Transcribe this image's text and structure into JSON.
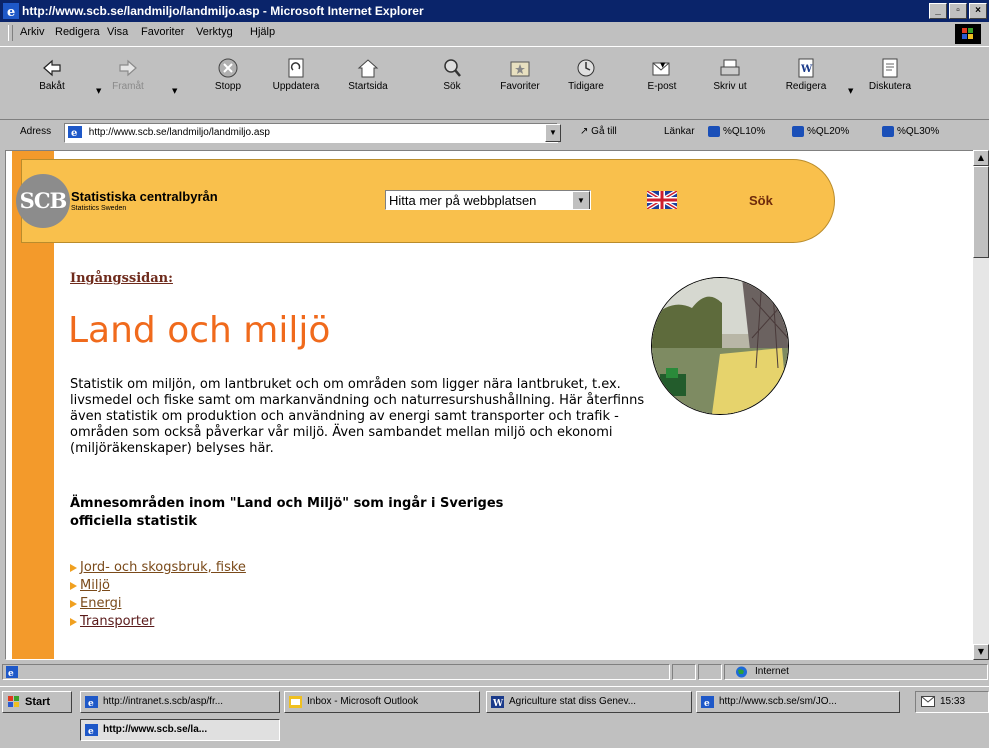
{
  "window": {
    "title": "http://www.scb.se/landmiljo/landmiljo.asp - Microsoft Internet Explorer"
  },
  "menu": [
    "Arkiv",
    "Redigera",
    "Visa",
    "Favoriter",
    "Verktyg",
    "Hjälp"
  ],
  "toolbar": {
    "back": "Bakåt",
    "forward": "Framåt",
    "stop": "Stopp",
    "refresh": "Uppdatera",
    "home": "Startsida",
    "search": "Sök",
    "favorites": "Favoriter",
    "history": "Tidigare",
    "mail": "E-post",
    "print": "Skriv ut",
    "edit": "Redigera",
    "discuss": "Diskutera"
  },
  "address": {
    "label": "Adress",
    "url": "http://www.scb.se/landmiljo/landmiljo.asp",
    "goto": "Gå till",
    "links_label": "Länkar",
    "links": [
      "%QL10%",
      "%QL20%",
      "%QL30%"
    ]
  },
  "page": {
    "org_name": "Statistiska centralbyrån",
    "org_sub": "Statistics Sweden",
    "logo_text": "SCB",
    "site_select": "Hitta mer på webbplatsen",
    "search_link": "Sök",
    "breadcrumb": "Ingångssidan:",
    "title": "Land och miljö",
    "intro": "Statistik om miljön, om lantbruket och om områden som ligger nära lantbruket, t.ex. livsmedel och fiske samt om markanvändning och naturresurshushållning. Här återfinns även statistik om produktion och användning av energi samt transporter och trafik - områden som också påverkar vår miljö. Även sambandet mellan miljö och ekonomi (miljöräkenskaper) belyses här.",
    "subheading": "Ämnesområden inom \"Land och Miljö\" som ingår i Sveriges officiella statistik",
    "topics": [
      "Jord- och skogsbruk, fiske",
      "Miljö",
      "Energi",
      "Transporter"
    ]
  },
  "status": {
    "zone": "Internet"
  },
  "taskbar": {
    "start": "Start",
    "tasks": [
      "http://intranet.s.scb/asp/fr...",
      "Inbox - Microsoft Outlook",
      "Agriculture stat diss Genev...",
      "http://www.scb.se/sm/JO...",
      "http://www.scb.se/la..."
    ],
    "clock": "15:33"
  },
  "colors": {
    "title_bar": "#0a246a",
    "accent_orange": "#f39a2b",
    "header_band": "#f9c04c",
    "title_orange": "#f06a1c"
  }
}
